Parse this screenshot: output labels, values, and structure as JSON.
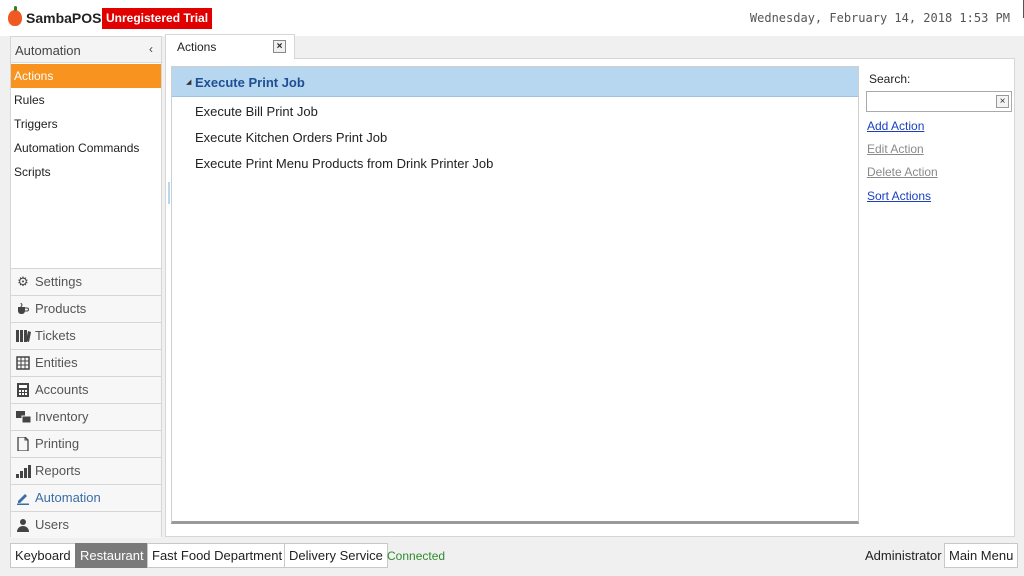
{
  "header": {
    "app_name": "SambaPOS",
    "trial_badge": "Unregistered Trial",
    "datetime": "Wednesday, February 14, 2018 1:53 PM"
  },
  "leftnav": {
    "section_title": "Automation",
    "collapse_glyph": "‹",
    "subitems": [
      {
        "label": "Actions",
        "active": true
      },
      {
        "label": "Rules"
      },
      {
        "label": "Triggers"
      },
      {
        "label": "Automation Commands"
      },
      {
        "label": "Scripts"
      }
    ],
    "modules": [
      {
        "label": "Settings",
        "icon": "gear-icon"
      },
      {
        "label": "Products",
        "icon": "coffee-cup-icon"
      },
      {
        "label": "Tickets",
        "icon": "tickets-icon"
      },
      {
        "label": "Entities",
        "icon": "table-icon"
      },
      {
        "label": "Accounts",
        "icon": "calculator-icon"
      },
      {
        "label": "Inventory",
        "icon": "inventory-icon"
      },
      {
        "label": "Printing",
        "icon": "document-icon"
      },
      {
        "label": "Reports",
        "icon": "bar-chart-icon"
      },
      {
        "label": "Automation",
        "icon": "pen-icon",
        "active": true
      },
      {
        "label": "Users",
        "icon": "user-icon"
      }
    ]
  },
  "tab": {
    "label": "Actions",
    "close_glyph": "×"
  },
  "list": {
    "group_label": "Execute Print Job",
    "group_arrow": "◢",
    "rows": [
      "Execute Bill Print Job",
      "Execute Kitchen Orders Print Job",
      "Execute Print Menu Products from Drink Printer Job"
    ]
  },
  "right_panel": {
    "search_label": "Search:",
    "search_value": "",
    "clear_glyph": "×",
    "actions": [
      {
        "label": "Add Action",
        "enabled": true
      },
      {
        "label": "Edit Action",
        "enabled": false
      },
      {
        "label": "Delete Action",
        "enabled": false
      },
      {
        "label": "Sort Actions",
        "enabled": true
      }
    ]
  },
  "footer": {
    "buttons": [
      {
        "label": "Keyboard"
      },
      {
        "label": "Restaurant",
        "selected": true
      },
      {
        "label": "Fast Food Department"
      },
      {
        "label": "Delivery Service"
      }
    ],
    "status": "Connected",
    "user": "Administrator",
    "main_menu": "Main Menu"
  },
  "colors": {
    "accent_orange": "#f7931e",
    "trial_red": "#e00000",
    "group_blue": "#b7d6f0",
    "link_blue": "#1a3fbf",
    "status_green": "#2e8b2e"
  }
}
